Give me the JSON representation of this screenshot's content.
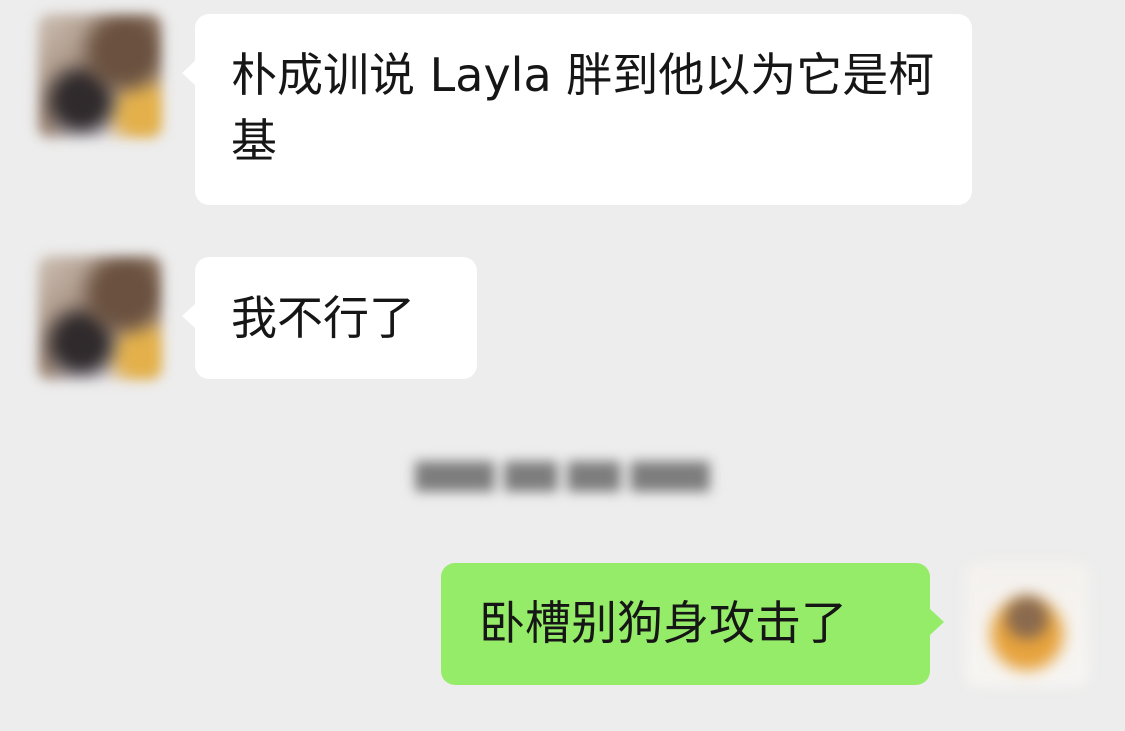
{
  "colors": {
    "background": "#ededed",
    "incoming_bubble": "#ffffff",
    "outgoing_bubble": "#95ec69",
    "text": "#161616"
  },
  "messages": [
    {
      "direction": "incoming",
      "text": "朴成训说 Layla 胖到他以为它是柯基"
    },
    {
      "direction": "incoming",
      "text": "我不行了"
    },
    {
      "direction": "outgoing",
      "text": "卧槽别狗身攻击了"
    }
  ]
}
